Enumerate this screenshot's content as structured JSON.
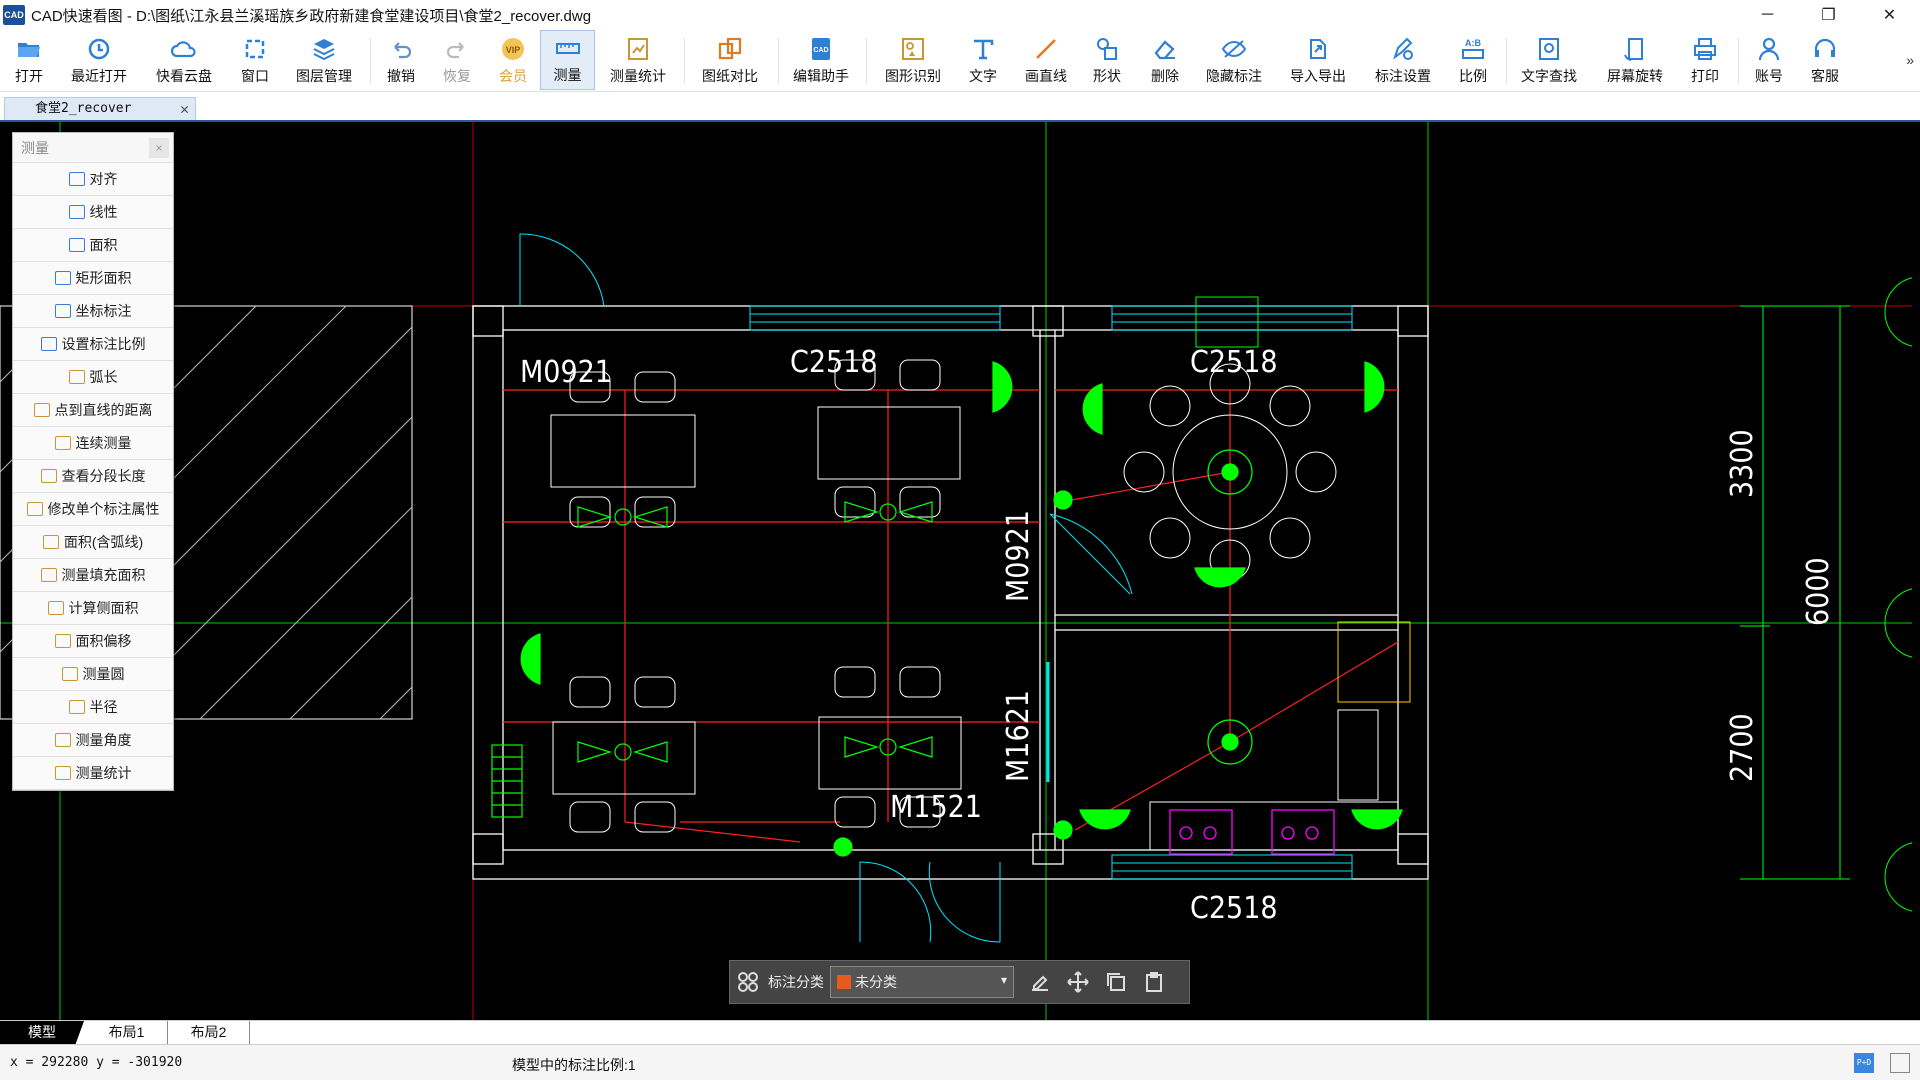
{
  "window": {
    "app_icon_text": "CAD",
    "title": "CAD快速看图 - D:\\图纸\\江永县兰溪瑶族乡政府新建食堂建设项目\\食堂2_recover.dwg",
    "minimize": "─",
    "maximize": "❐",
    "close": "✕"
  },
  "toolbar": {
    "items": [
      {
        "label": "打开",
        "icon": "folder-open-icon"
      },
      {
        "label": "最近打开",
        "icon": "clock-icon"
      },
      {
        "label": "快看云盘",
        "icon": "cloud-icon"
      },
      {
        "label": "窗口",
        "icon": "window-icon"
      },
      {
        "label": "图层管理",
        "icon": "layers-icon"
      },
      {
        "label": "撤销",
        "icon": "undo-icon"
      },
      {
        "label": "恢复",
        "icon": "redo-icon"
      },
      {
        "label": "会员",
        "icon": "vip-icon"
      },
      {
        "label": "测量",
        "icon": "measure-ruler-icon"
      },
      {
        "label": "测量统计",
        "icon": "measure-stats-icon"
      },
      {
        "label": "图纸对比",
        "icon": "compare-icon"
      },
      {
        "label": "编辑助手",
        "icon": "edit-assistant-icon"
      },
      {
        "label": "图形识别",
        "icon": "shape-recognize-icon"
      },
      {
        "label": "文字",
        "icon": "text-icon"
      },
      {
        "label": "画直线",
        "icon": "line-icon"
      },
      {
        "label": "形状",
        "icon": "shapes-icon"
      },
      {
        "label": "删除",
        "icon": "eraser-icon"
      },
      {
        "label": "隐藏标注",
        "icon": "hide-eye-icon"
      },
      {
        "label": "导入导出",
        "icon": "import-export-icon"
      },
      {
        "label": "标注设置",
        "icon": "annotation-settings-icon"
      },
      {
        "label": "比例",
        "icon": "scale-icon"
      },
      {
        "label": "文字查找",
        "icon": "text-search-icon"
      },
      {
        "label": "屏幕旋转",
        "icon": "rotate-screen-icon"
      },
      {
        "label": "打印",
        "icon": "printer-icon"
      },
      {
        "label": "账号",
        "icon": "user-icon"
      },
      {
        "label": "客服",
        "icon": "headset-icon"
      }
    ],
    "more": "»"
  },
  "doc_tab": {
    "label": "食堂2_recover",
    "close": "✕"
  },
  "measure_panel": {
    "title": "测量",
    "close": "×",
    "items": [
      "对齐",
      "线性",
      "面积",
      "矩形面积",
      "坐标标注",
      "设置标注比例",
      "弧长",
      "点到直线的距离",
      "连续测量",
      "查看分段长度",
      "修改单个标注属性",
      "面积(含弧线)",
      "测量填充面积",
      "计算侧面积",
      "面积偏移",
      "测量圆",
      "半径",
      "测量角度",
      "测量统计"
    ]
  },
  "drawing": {
    "labels": {
      "door1": "M0921",
      "window_top1": "C2518",
      "window_top2": "C2518",
      "door_mid": "M0921",
      "door_m1621": "M1621",
      "door_m1521": "M1521",
      "window_bottom": "C2518",
      "dim_3300": "3300",
      "dim_6000": "6000",
      "dim_2700": "2700"
    },
    "colors": {
      "wall": "#ffffff",
      "red_line": "#ff2020",
      "green": "#00ff00",
      "cyan": "#00e5ff",
      "magenta": "#ff00ff",
      "yellow": "#ffcc00"
    }
  },
  "annotation_bar": {
    "label": "标注分类",
    "category": "未分类",
    "category_color": "#e65a1e",
    "caret": "▾"
  },
  "layout_tabs": [
    "模型",
    "布局1",
    "布局2"
  ],
  "status": {
    "coords": "x = 292280  y = -301920",
    "scale": "模型中的标注比例:1",
    "icon1_text": "P+D"
  }
}
